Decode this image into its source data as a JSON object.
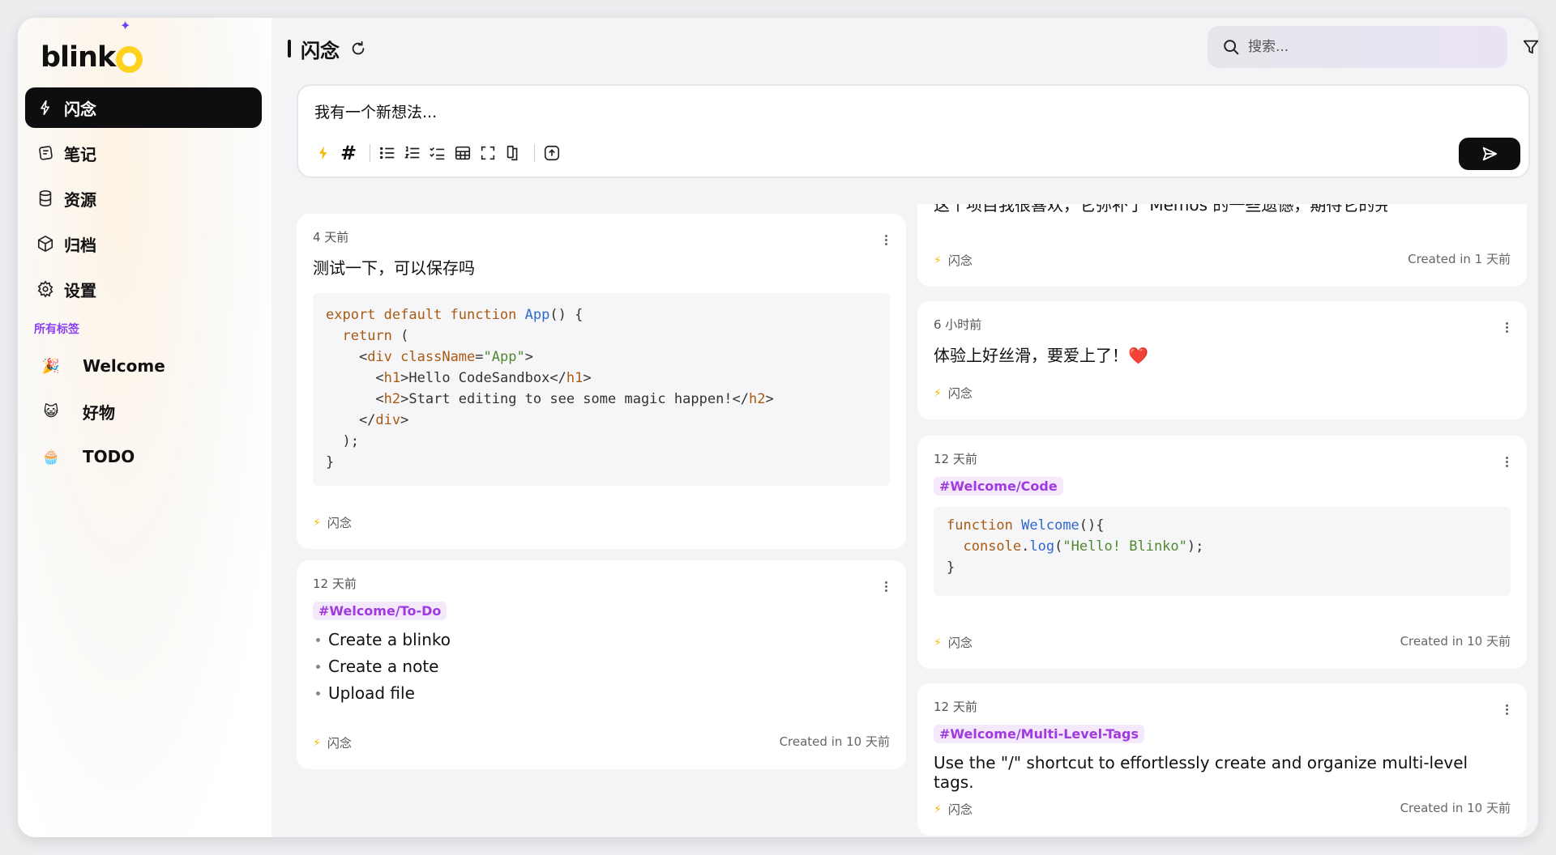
{
  "app": {
    "logo_text": "blink"
  },
  "sidebar": {
    "items": [
      {
        "label": "闪念",
        "icon": "bolt-icon",
        "active": true
      },
      {
        "label": "笔记",
        "icon": "notes-icon",
        "active": false
      },
      {
        "label": "资源",
        "icon": "database-icon",
        "active": false
      },
      {
        "label": "归档",
        "icon": "archive-icon",
        "active": false
      },
      {
        "label": "设置",
        "icon": "gear-icon",
        "active": false
      }
    ],
    "tags_title": "所有标签",
    "tags": [
      {
        "emoji": "🎉",
        "label": "Welcome"
      },
      {
        "emoji": "😺",
        "label": "好物"
      },
      {
        "emoji": "🧁",
        "label": "TODO"
      }
    ]
  },
  "header": {
    "title": "闪念"
  },
  "search": {
    "placeholder": "搜索..."
  },
  "editor": {
    "placeholder": "我有一个新想法..."
  },
  "cards": {
    "c1": {
      "time": "4 天前",
      "text": "测试一下，可以保存吗",
      "type": "闪念"
    },
    "c2": {
      "time": "12 天前",
      "tag": "#Welcome/To-Do",
      "items": [
        "Create a blinko",
        "Create a note",
        "Upload file"
      ],
      "type": "闪念",
      "created": "Created in 10 天前"
    },
    "c3": {
      "partial_text": "这个项目我很喜欢，它弥补了 Memos 的一些遗憾，期待它的完善",
      "type": "闪念",
      "created": "Created in 1 天前"
    },
    "c4": {
      "time": "6 小时前",
      "text": "体验上好丝滑，要爱上了！❤️",
      "type": "闪念"
    },
    "c5": {
      "time": "12 天前",
      "tag": "#Welcome/Code",
      "type": "闪念",
      "created": "Created in 10 天前"
    },
    "c6": {
      "time": "12 天前",
      "tag": "#Welcome/Multi-Level-Tags",
      "text": "Use the \"/\" shortcut to effortlessly create and organize multi-level tags.",
      "type": "闪念",
      "created": "Created in 10 天前"
    }
  },
  "colors": {
    "accent": "#a03ae0",
    "active_nav": "#0e0e10",
    "bolt": "#f5b800"
  }
}
